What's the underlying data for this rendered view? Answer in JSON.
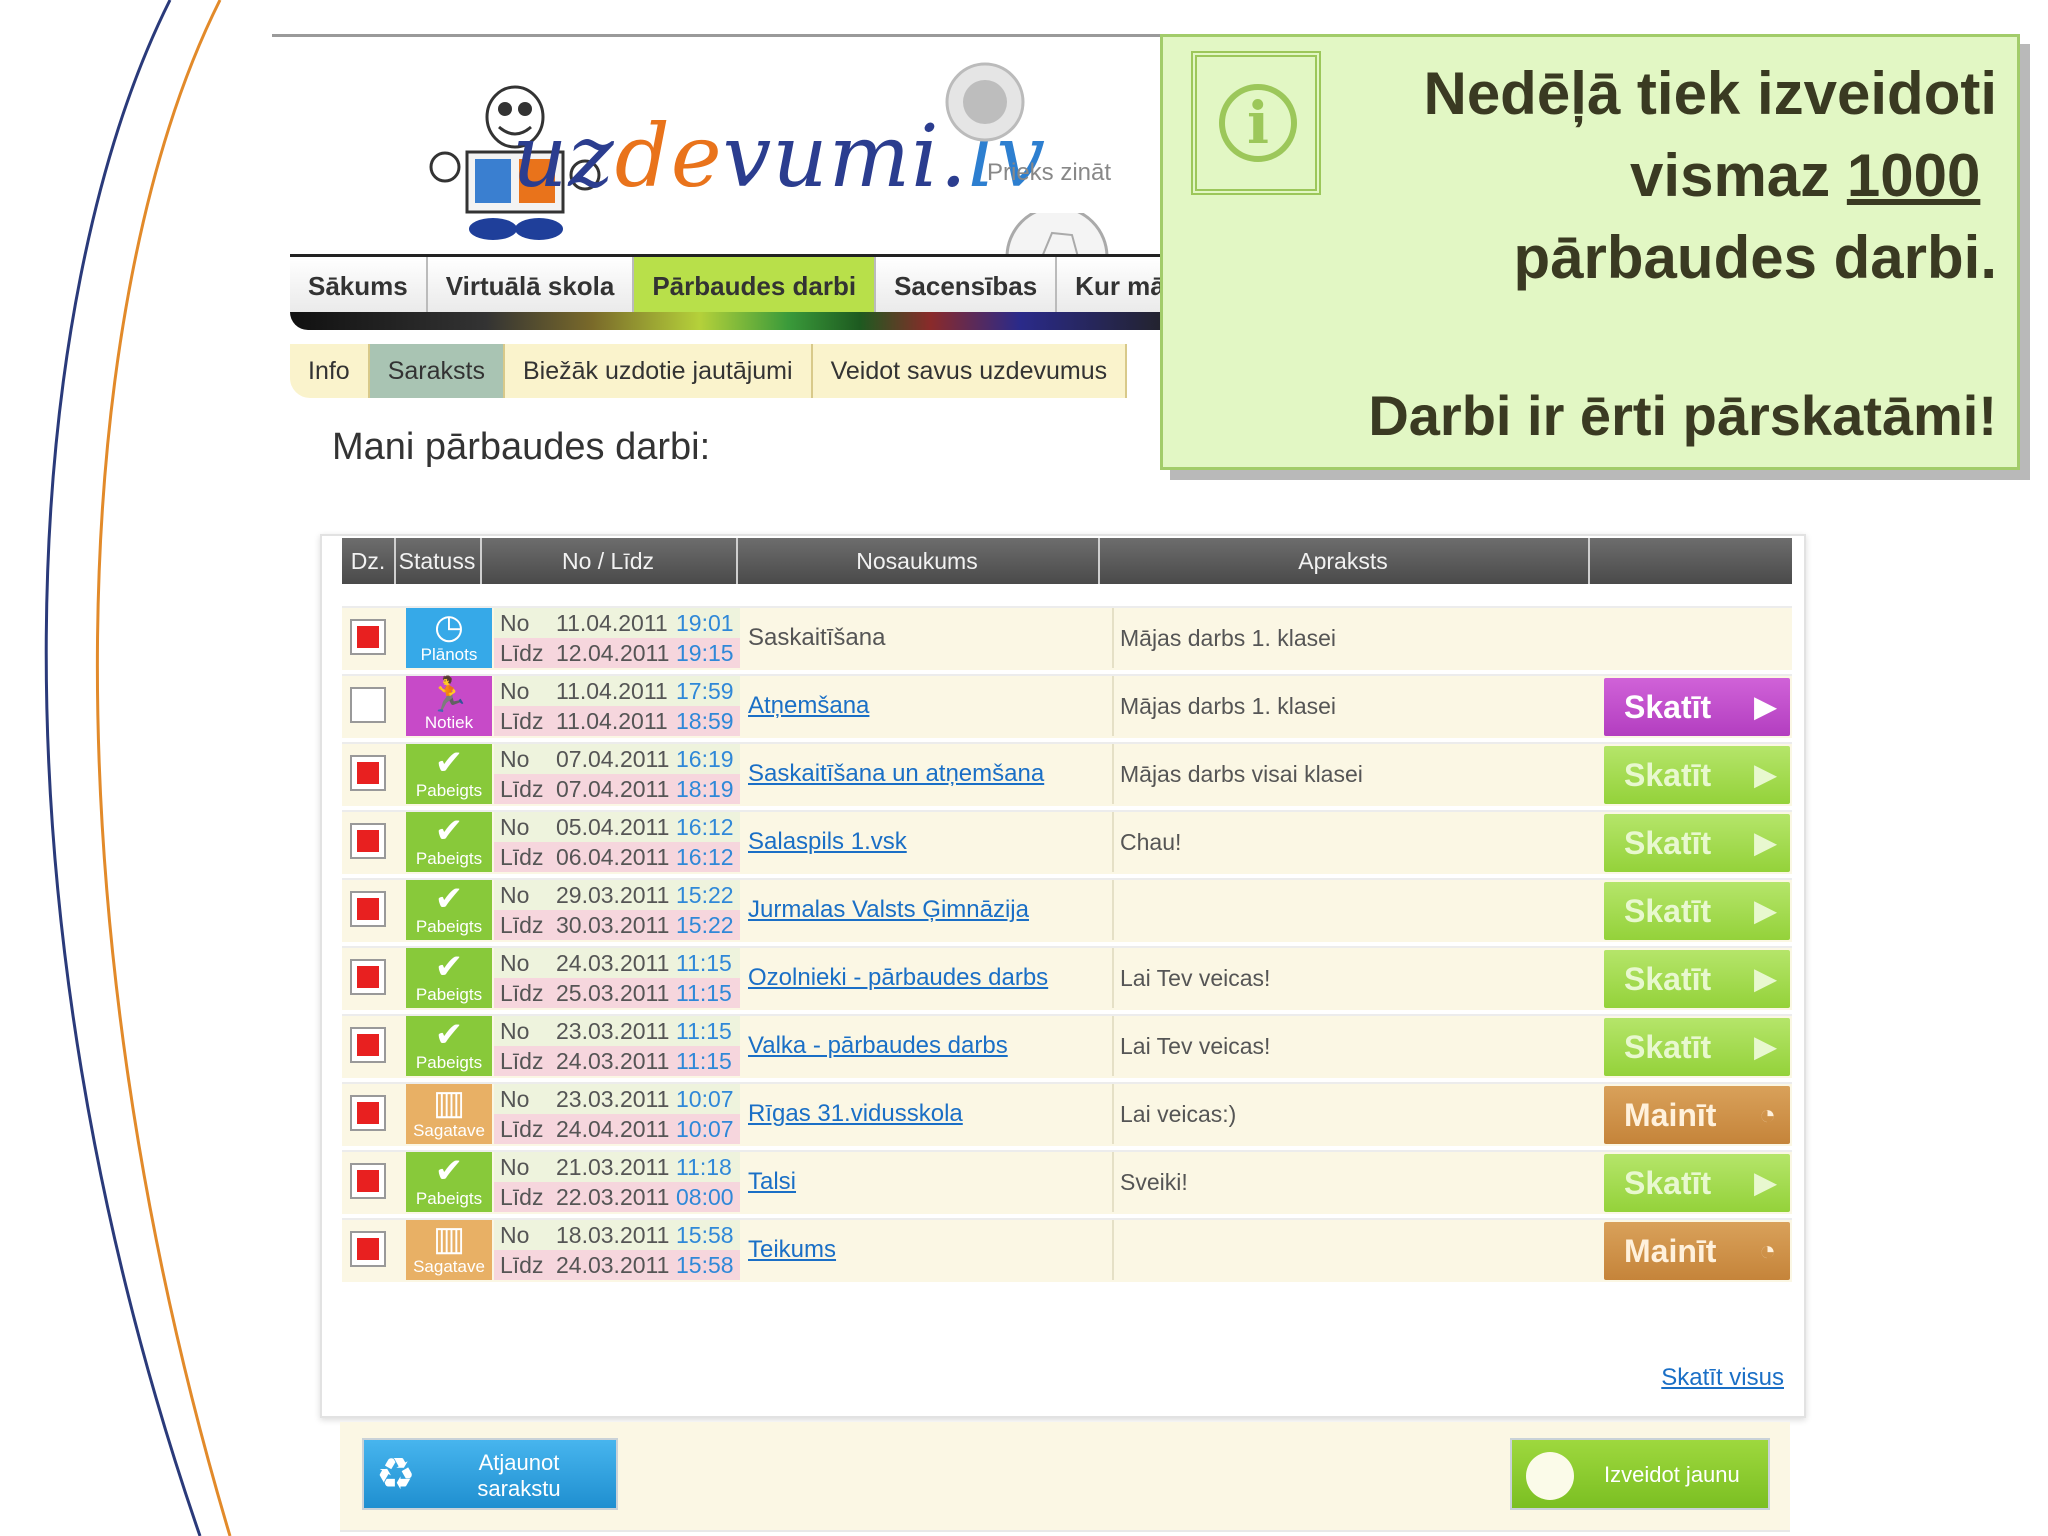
{
  "site": {
    "logo_main": "uz",
    "logo_accent": "de",
    "logo_tail": "vumi.",
    "logo_lv": "lv",
    "slogan": "Prieks zināt"
  },
  "main_nav": [
    "Sākums",
    "Virtuālā skola",
    "Pārbaudes darbi",
    "Sacensības",
    "Kur mā"
  ],
  "sub_nav": [
    "Info",
    "Saraksts",
    "Biežāk uzdotie jautājumi",
    "Veidot savus uzdevumus"
  ],
  "page_title": "Mani pārbaudes darbi:",
  "table": {
    "headers": [
      "Dz.",
      "Statuss",
      "No / Līdz",
      "Nosaukums",
      "Apraksts"
    ],
    "from_label": "No",
    "to_label": "Līdz",
    "rows": [
      {
        "checked": true,
        "status": "Plānots",
        "status_icon": "clock-icon",
        "from_date": "11.04.2011",
        "from_time": "19:01",
        "to_date": "12.04.2011",
        "to_time": "19:15",
        "name": "Saskaitīšana",
        "linked": false,
        "desc": "Mājas darbs 1. klasei",
        "action": ""
      },
      {
        "checked": false,
        "status": "Notiek",
        "status_icon": "running-icon",
        "from_date": "11.04.2011",
        "from_time": "17:59",
        "to_date": "11.04.2011",
        "to_time": "18:59",
        "name": "Atņemšana",
        "linked": true,
        "desc": "Mājas darbs 1. klasei",
        "action": "Skatīt"
      },
      {
        "checked": true,
        "status": "Pabeigts",
        "status_icon": "checkmark-icon",
        "from_date": "07.04.2011",
        "from_time": "16:19",
        "to_date": "07.04.2011",
        "to_time": "18:19",
        "name": "Saskaitīšana un atņemšana",
        "linked": true,
        "desc": "Mājas darbs visai klasei",
        "action": "Skatīt"
      },
      {
        "checked": true,
        "status": "Pabeigts",
        "status_icon": "checkmark-icon",
        "from_date": "05.04.2011",
        "from_time": "16:12",
        "to_date": "06.04.2011",
        "to_time": "16:12",
        "name": "Salaspils 1.vsk",
        "linked": true,
        "desc": "Chau!",
        "action": "Skatīt"
      },
      {
        "checked": true,
        "status": "Pabeigts",
        "status_icon": "checkmark-icon",
        "from_date": "29.03.2011",
        "from_time": "15:22",
        "to_date": "30.03.2011",
        "to_time": "15:22",
        "name": "Jurmalas Valsts Ģimnāzija",
        "linked": true,
        "desc": "",
        "action": "Skatīt"
      },
      {
        "checked": true,
        "status": "Pabeigts",
        "status_icon": "checkmark-icon",
        "from_date": "24.03.2011",
        "from_time": "11:15",
        "to_date": "25.03.2011",
        "to_time": "11:15",
        "name": "Ozolnieki - pārbaudes darbs",
        "linked": true,
        "desc": "Lai Tev veicas!",
        "action": "Skatīt"
      },
      {
        "checked": true,
        "status": "Pabeigts",
        "status_icon": "checkmark-icon",
        "from_date": "23.03.2011",
        "from_time": "11:15",
        "to_date": "24.03.2011",
        "to_time": "11:15",
        "name": "Valka - pārbaudes darbs",
        "linked": true,
        "desc": "Lai Tev veicas!",
        "action": "Skatīt"
      },
      {
        "checked": true,
        "status": "Sagatave",
        "status_icon": "barcode-icon",
        "from_date": "23.03.2011",
        "from_time": "10:07",
        "to_date": "24.04.2011",
        "to_time": "10:07",
        "name": "Rīgas 31.vidusskola",
        "linked": true,
        "desc": "Lai veicas:)",
        "action": "Mainīt"
      },
      {
        "checked": true,
        "status": "Pabeigts",
        "status_icon": "checkmark-icon",
        "from_date": "21.03.2011",
        "from_time": "11:18",
        "to_date": "22.03.2011",
        "to_time": "08:00",
        "name": "Talsi",
        "linked": true,
        "desc": "Sveiki!",
        "action": "Skatīt"
      },
      {
        "checked": true,
        "status": "Sagatave",
        "status_icon": "barcode-icon",
        "from_date": "18.03.2011",
        "from_time": "15:58",
        "to_date": "24.03.2011",
        "to_time": "15:58",
        "name": "Teikums",
        "linked": true,
        "desc": "",
        "action": "Mainīt"
      }
    ],
    "view_all": "Skatīt visus"
  },
  "buttons": {
    "refresh_label": "Atjaunot\nsarakstu",
    "create_label": "Izveidot jaunu"
  },
  "callout": {
    "line1": "Nedēļā tiek izveidoti",
    "line2_pre": "vismaz ",
    "line2_num": "1000",
    "line3": "pārbaudes darbi.",
    "sub": "Darbi ir ērti pārskatāmi!"
  },
  "colors": {
    "planots": "#36a9e8",
    "notiek": "#c74ac8",
    "pabeigts": "#88c93a",
    "sagatave": "#e8b065",
    "callout_bg": "#e2f7c4"
  }
}
